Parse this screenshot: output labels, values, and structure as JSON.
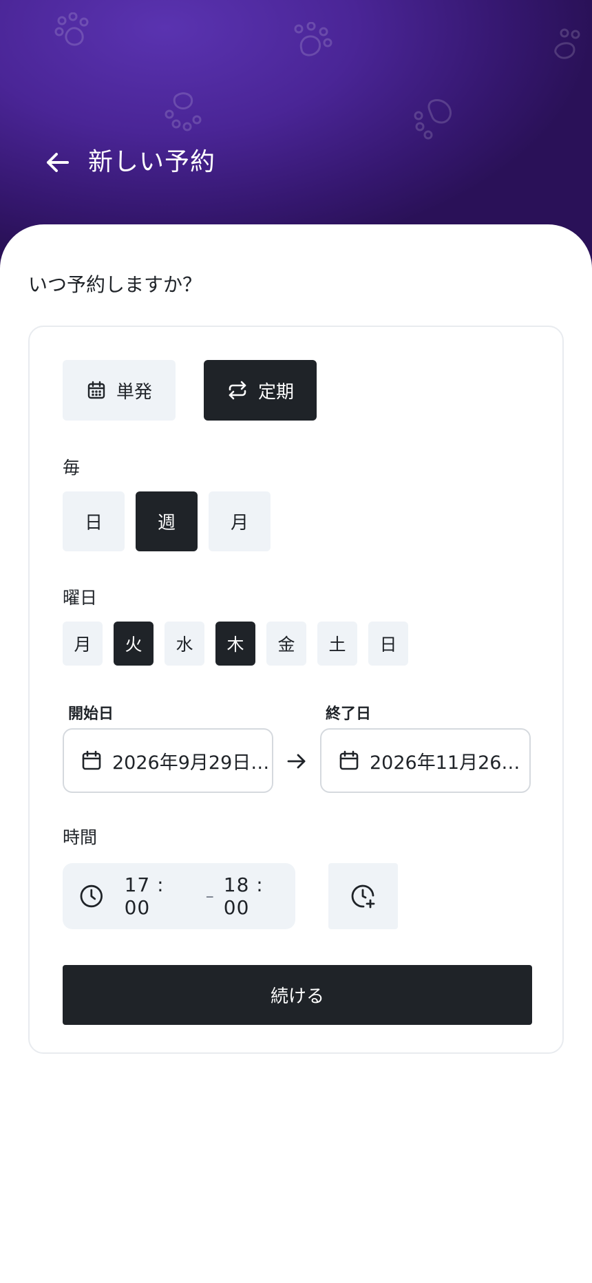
{
  "header": {
    "title": "新しい予約",
    "background_color": "#4a2596"
  },
  "question": "いつ予約しますか？",
  "mode": {
    "single_label": "単発",
    "recurring_label": "定期",
    "selected": "recurring"
  },
  "frequency": {
    "label": "毎",
    "options": [
      "日",
      "週",
      "月"
    ],
    "selected": "週"
  },
  "weekdays": {
    "label": "曜日",
    "days": [
      "月",
      "火",
      "水",
      "木",
      "金",
      "土",
      "日"
    ],
    "selected": [
      "火",
      "木"
    ]
  },
  "dates": {
    "start_label": "開始日",
    "start_value": "2026年9月29日…",
    "end_label": "終了日",
    "end_value": "2026年11月26…"
  },
  "time": {
    "label": "時間",
    "start": "17 : 00",
    "separator": "–",
    "end": "18 : 00"
  },
  "continue_label": "続ける",
  "colors": {
    "dark": "#1f2328",
    "light": "#eff3f7",
    "accent": "#4a2596"
  }
}
